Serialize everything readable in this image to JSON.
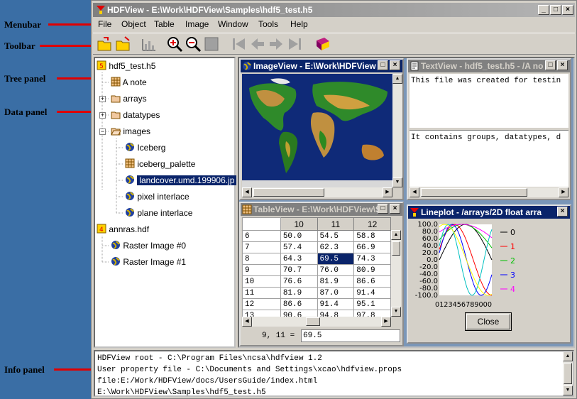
{
  "callouts": {
    "menubar": "Menubar",
    "toolbar": "Toolbar",
    "tree_panel": "Tree panel",
    "data_panel": "Data panel",
    "info_panel": "Info panel"
  },
  "window": {
    "title": "HDFView - E:\\Work\\HDFView\\Samples\\hdf5_test.h5",
    "minimize": "_",
    "maximize": "□",
    "close": "×"
  },
  "menubar": [
    "File",
    "Object",
    "Table",
    "Image",
    "Window",
    "Tools",
    "Help"
  ],
  "toolbar": {
    "icons": [
      "open-icon",
      "close-file-icon",
      "chart-icon",
      "zoom-in-icon",
      "zoom-out-icon",
      "show-icon",
      "first-icon",
      "previous-icon",
      "next-icon",
      "last-icon",
      "help-book-icon"
    ]
  },
  "tree": {
    "file1": "hdf5_test.h5",
    "note": "A note",
    "arrays": "arrays",
    "datatypes": "datatypes",
    "images": "images",
    "iceberg": "Iceberg",
    "iceberg_palette": "iceberg_palette",
    "landcover": "landcover.umd.199906.jp",
    "pixel_interlace": "pixel interlace",
    "plane_interlace": "plane interlace",
    "file2": "annras.hdf",
    "raster0": "Raster Image #0",
    "raster1": "Raster Image #1"
  },
  "imageview": {
    "title": "ImageView - E:\\Work\\HDFView"
  },
  "textview": {
    "title": "TextView - hdf5_test.h5 - /A no",
    "line1": "This file was created for testin",
    "line2": "It contains groups, datatypes, d"
  },
  "tableview": {
    "title": "TableView - E:\\Work\\HDFView\\S",
    "columns": [
      "10",
      "11",
      "12"
    ],
    "rows": [
      {
        "idx": "6",
        "c10": "50.0",
        "c11": "54.5",
        "c12": "58.8"
      },
      {
        "idx": "7",
        "c10": "57.4",
        "c11": "62.3",
        "c12": "66.9"
      },
      {
        "idx": "8",
        "c10": "64.3",
        "c11": "69.5",
        "c12": "74.3"
      },
      {
        "idx": "9",
        "c10": "70.7",
        "c11": "76.0",
        "c12": "80.9"
      },
      {
        "idx": "10",
        "c10": "76.6",
        "c11": "81.9",
        "c12": "86.6"
      },
      {
        "idx": "11",
        "c10": "81.9",
        "c11": "87.0",
        "c12": "91.4"
      },
      {
        "idx": "12",
        "c10": "86.6",
        "c11": "91.4",
        "c12": "95.1"
      },
      {
        "idx": "13",
        "c10": "90.6",
        "c11": "94.8",
        "c12": "97.8"
      }
    ],
    "cell_label": "9, 11 =",
    "cell_value": "69.5"
  },
  "lineplot": {
    "title": "Lineplot - /arrays/2D float arra",
    "y_ticks": [
      "100.0",
      "80.0",
      "60.0",
      "40.0",
      "20.0",
      "0.0",
      "-20.0",
      "-40.0",
      "-60.0",
      "-80.0",
      "-100.0"
    ],
    "x_ticks": "012345678910111213141516171819",
    "x_ticks_shown": "0123456789000",
    "legend": [
      "0",
      "1",
      "2",
      "3",
      "4"
    ],
    "colors": [
      "#000000",
      "#ff0000",
      "#00c000",
      "#0000ff",
      "#ff00ff",
      "#00c0c0",
      "#ffff00"
    ],
    "close_label": "Close"
  },
  "info": {
    "lines": [
      "HDFView root - C:\\Program Files\\ncsa\\hdfview 1.2",
      "User property file - C:\\Documents and Settings\\xcao\\hdfview.props",
      "file:E:/Work/HDFView/docs/UsersGuide/index.html",
      "E:\\Work\\HDFView\\Samples\\hdf5_test.h5"
    ]
  }
}
